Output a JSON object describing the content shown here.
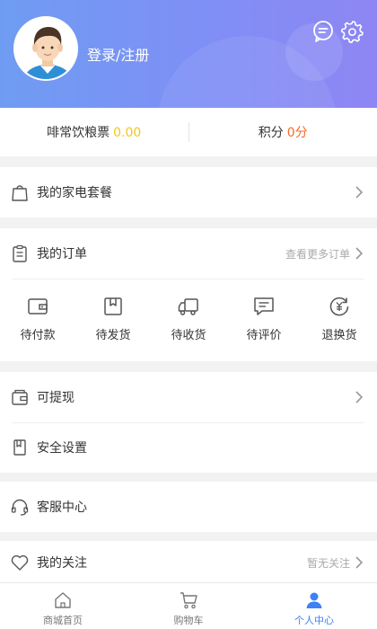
{
  "header": {
    "login_label": "登录/注册",
    "message_icon": "message-icon",
    "settings_icon": "gear-icon"
  },
  "stats": {
    "coupon_label": "啡常饮粮票",
    "coupon_value": "0.00",
    "points_label": "积分",
    "points_value": "0分"
  },
  "package": {
    "label": "我的家电套餐"
  },
  "orders": {
    "title": "我的订单",
    "more_label": "查看更多订单",
    "items": [
      {
        "label": "待付款",
        "icon": "wallet-icon"
      },
      {
        "label": "待发货",
        "icon": "box-icon"
      },
      {
        "label": "待收货",
        "icon": "truck-icon"
      },
      {
        "label": "待评价",
        "icon": "comment-icon"
      },
      {
        "label": "退换货",
        "icon": "refund-icon"
      }
    ]
  },
  "withdraw": {
    "label": "可提现"
  },
  "security": {
    "label": "安全设置"
  },
  "service": {
    "label": "客服中心"
  },
  "follow": {
    "label": "我的关注",
    "status": "暂无关注"
  },
  "tabbar": {
    "items": [
      {
        "label": "商城首页",
        "icon": "home-icon"
      },
      {
        "label": "购物车",
        "icon": "cart-icon"
      },
      {
        "label": "个人中心",
        "icon": "user-icon",
        "active": true
      }
    ]
  },
  "colors": {
    "accent": "#3b82f6",
    "header_gradient_start": "#6f9cf3",
    "header_gradient_end": "#8e86f4",
    "coupon_value": "#f5c518",
    "points_value": "#f26b2a"
  }
}
